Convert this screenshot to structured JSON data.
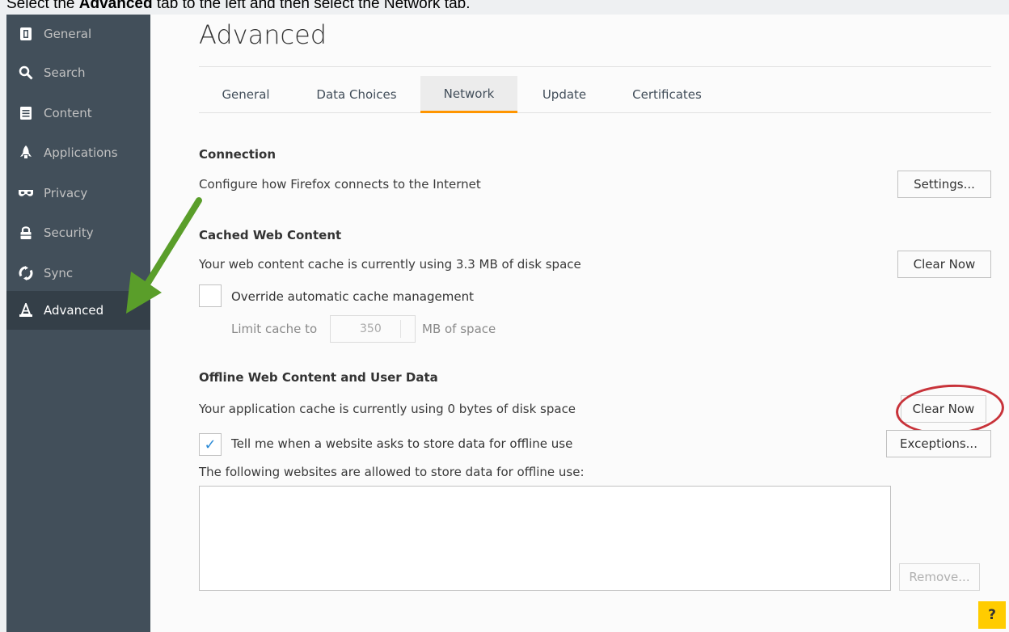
{
  "instruction": {
    "prefix": "Select the ",
    "bold": "Advanced",
    "suffix": " tab to the left and then select the Network tab."
  },
  "sidebar": {
    "items": [
      {
        "label": "General",
        "icon": "general-icon"
      },
      {
        "label": "Search",
        "icon": "search-icon"
      },
      {
        "label": "Content",
        "icon": "content-icon"
      },
      {
        "label": "Applications",
        "icon": "applications-icon"
      },
      {
        "label": "Privacy",
        "icon": "privacy-mask-icon"
      },
      {
        "label": "Security",
        "icon": "lock-icon"
      },
      {
        "label": "Sync",
        "icon": "sync-icon"
      },
      {
        "label": "Advanced",
        "icon": "wizard-hat-icon",
        "active": true
      }
    ]
  },
  "main": {
    "title": "Advanced",
    "tabs": [
      {
        "label": "General"
      },
      {
        "label": "Data Choices"
      },
      {
        "label": "Network",
        "active": true
      },
      {
        "label": "Update"
      },
      {
        "label": "Certificates"
      }
    ],
    "connection": {
      "title": "Connection",
      "desc": "Configure how Firefox connects to the Internet",
      "button": "Settings..."
    },
    "cache": {
      "title": "Cached Web Content",
      "desc": "Your web content cache is currently using 3.3 MB of disk space",
      "button": "Clear Now",
      "override_label": "Override automatic cache management",
      "override_checked": false,
      "limit_label": "Limit cache to",
      "limit_value": "350",
      "limit_unit": "MB of space"
    },
    "offline": {
      "title": "Offline Web Content and User Data",
      "desc": "Your application cache is currently using 0 bytes of disk space",
      "button": "Clear Now",
      "tell_label": "Tell me when a website asks to store data for offline use",
      "tell_checked": true,
      "exceptions_button": "Exceptions...",
      "allowed_label": "The following websites are allowed to store data for offline use:",
      "remove_button": "Remove..."
    },
    "help_label": "?"
  },
  "colors": {
    "sidebar_bg": "#424f5a",
    "sidebar_active": "#343f48",
    "tab_accent": "#ff9500",
    "highlight": "#c8333a",
    "arrow": "#5a9e2a",
    "help_bg": "#ffcc00"
  }
}
